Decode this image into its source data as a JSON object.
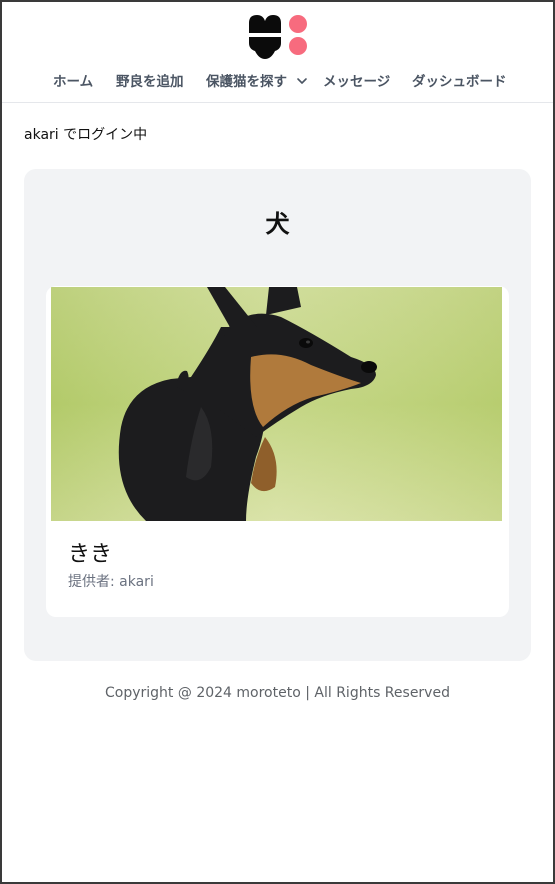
{
  "colors": {
    "logo_dark": "#0b0b0b",
    "logo_accent": "#f76b7e",
    "panel_bg": "#f2f3f5",
    "nav_text": "#4b5563",
    "muted_text": "#6b7280"
  },
  "header": {
    "logo_icon": "paw-logo-icon",
    "nav": {
      "items": [
        {
          "label": "ホーム"
        },
        {
          "label": "野良を追加"
        },
        {
          "label": "保護猫を探す",
          "icon": "chevron-down-icon"
        },
        {
          "label": "メッセージ"
        },
        {
          "label": "ダッシュボード"
        }
      ]
    }
  },
  "login_status": "akari でログイン中",
  "category": {
    "title": "犬",
    "pets": [
      {
        "name": "きき",
        "provider": "提供者: akari"
      }
    ]
  },
  "footer": {
    "copyright": "Copyright @ 2024 moroteto | All Rights Reserved"
  }
}
